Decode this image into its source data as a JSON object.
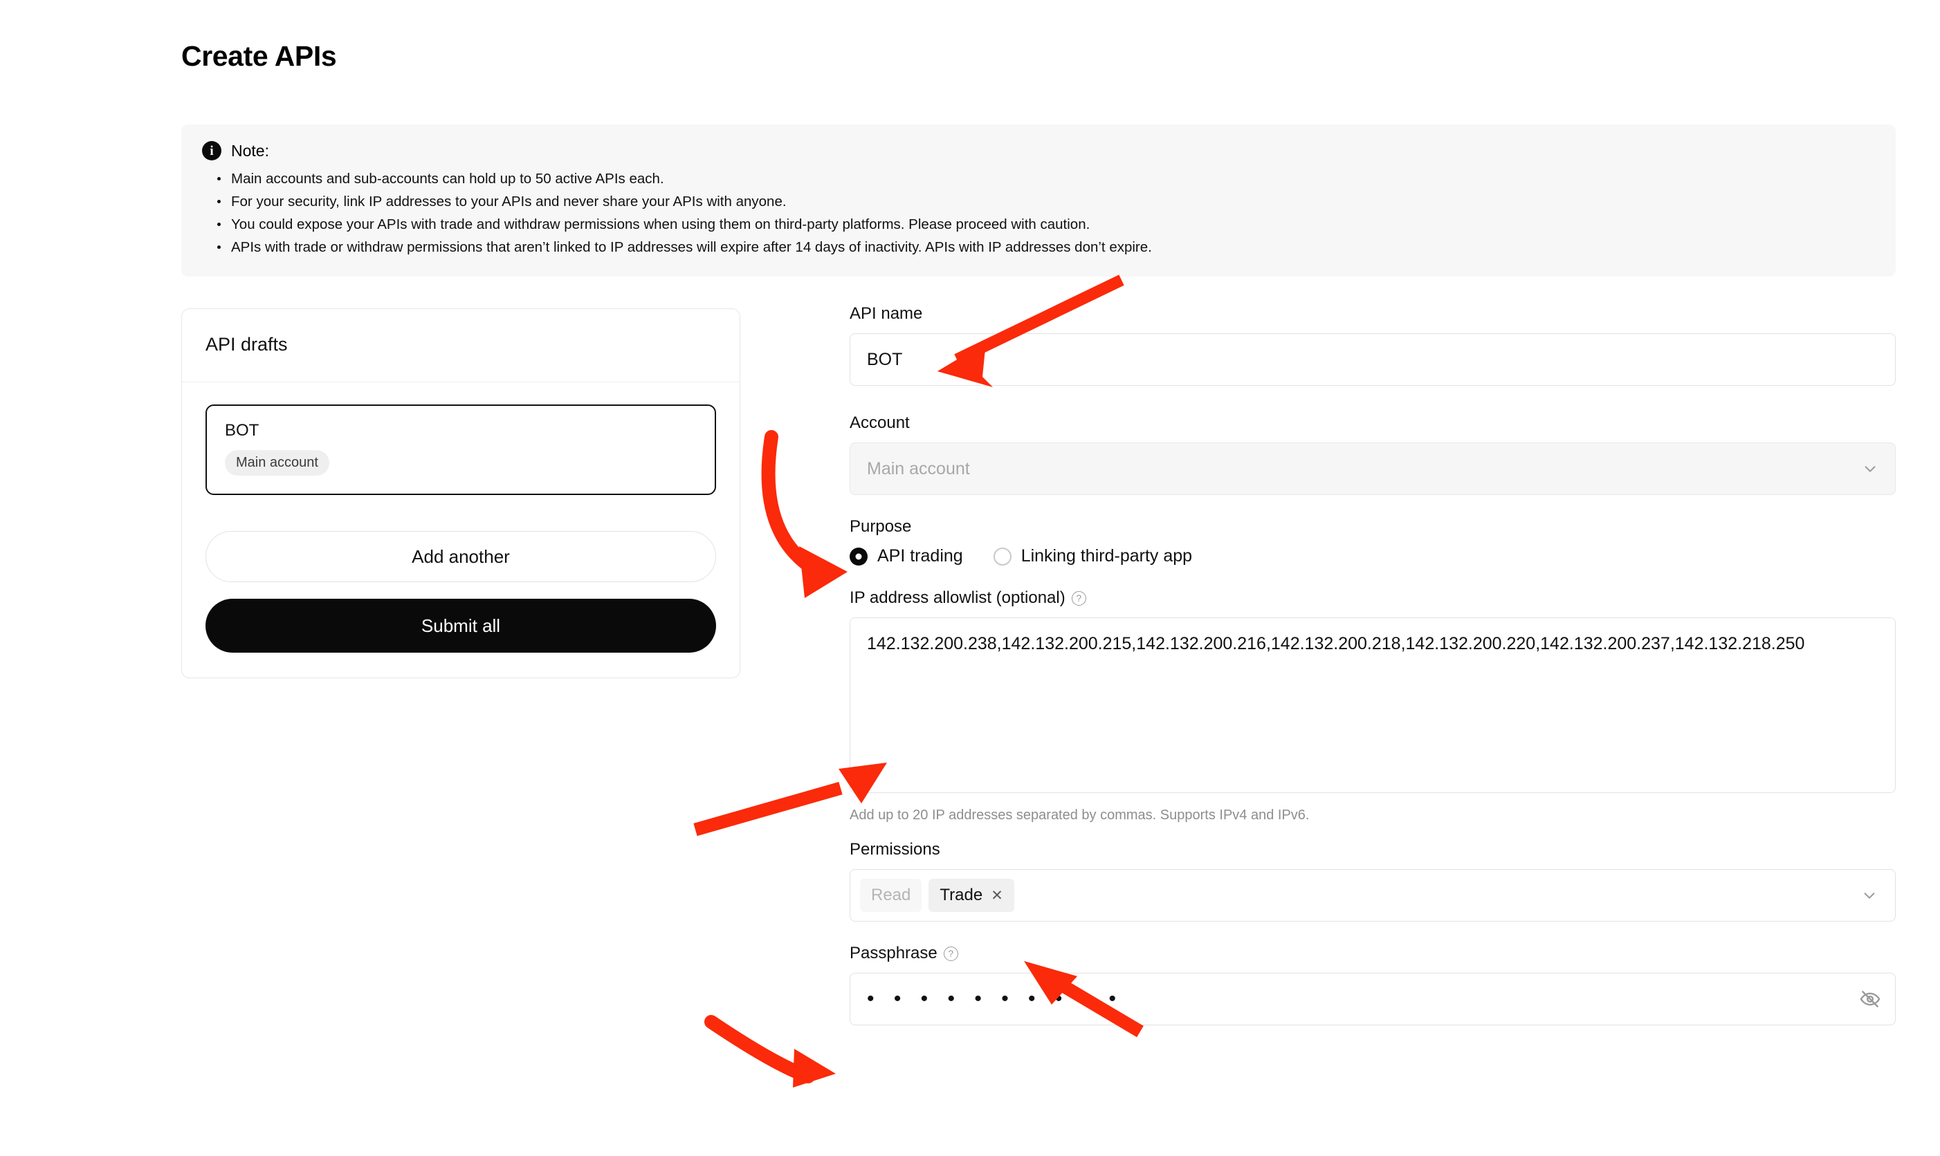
{
  "page": {
    "title": "Create APIs"
  },
  "note": {
    "icon": "info-icon",
    "title": "Note:",
    "items": [
      "Main accounts and sub-accounts can hold up to 50 active APIs each.",
      "For your security, link IP addresses to your APIs and never share your APIs with anyone.",
      "You could expose your APIs with trade and withdraw permissions when using them on third-party platforms. Please proceed with caution.",
      "APIs with trade or withdraw permissions that aren’t linked to IP addresses will expire after 14 days of inactivity. APIs with IP addresses don’t expire."
    ]
  },
  "drafts": {
    "header": "API drafts",
    "items": [
      {
        "name": "BOT",
        "badge": "Main account"
      }
    ],
    "add_another_label": "Add another",
    "submit_all_label": "Submit all"
  },
  "form": {
    "api_name": {
      "label": "API name",
      "value": "BOT",
      "placeholder": "API name"
    },
    "account": {
      "label": "Account",
      "value": "Main account",
      "disabled": true,
      "chevron_icon": "chevron-down-icon"
    },
    "purpose": {
      "label": "Purpose",
      "options": [
        {
          "label": "API trading",
          "selected": true
        },
        {
          "label": "Linking third-party app",
          "selected": false
        }
      ]
    },
    "ip_allowlist": {
      "label": "IP address allowlist (optional)",
      "help_icon": "help-circle-icon",
      "value": "142.132.200.238,142.132.200.215,142.132.200.216,142.132.200.218,142.132.200.220,142.132.200.237,142.132.218.250",
      "helper_text": "Add up to 20 IP addresses separated by commas. Supports IPv4 and IPv6."
    },
    "permissions": {
      "label": "Permissions",
      "chips": [
        {
          "label": "Read",
          "state": "disabled",
          "removable": false
        },
        {
          "label": "Trade",
          "state": "selected",
          "removable": true,
          "remove_icon": "close-icon"
        }
      ],
      "chevron_icon": "chevron-down-icon"
    },
    "passphrase": {
      "label": "Passphrase",
      "help_icon": "help-circle-icon",
      "masked_value": "• • • • • • • • • •",
      "toggle_icon": "eye-off-icon"
    }
  },
  "annotations": {
    "color": "#FA2A0A",
    "arrows": [
      {
        "name": "arrow-to-api-name",
        "target": "api-name-input"
      },
      {
        "name": "arrow-to-purpose",
        "target": "purpose-label"
      },
      {
        "name": "arrow-to-ip-allowlist",
        "target": "ip-allowlist-textarea"
      },
      {
        "name": "arrow-to-trade-chip",
        "target": "permission-chip-trade"
      },
      {
        "name": "arrow-to-passphrase",
        "target": "passphrase-input"
      }
    ]
  }
}
